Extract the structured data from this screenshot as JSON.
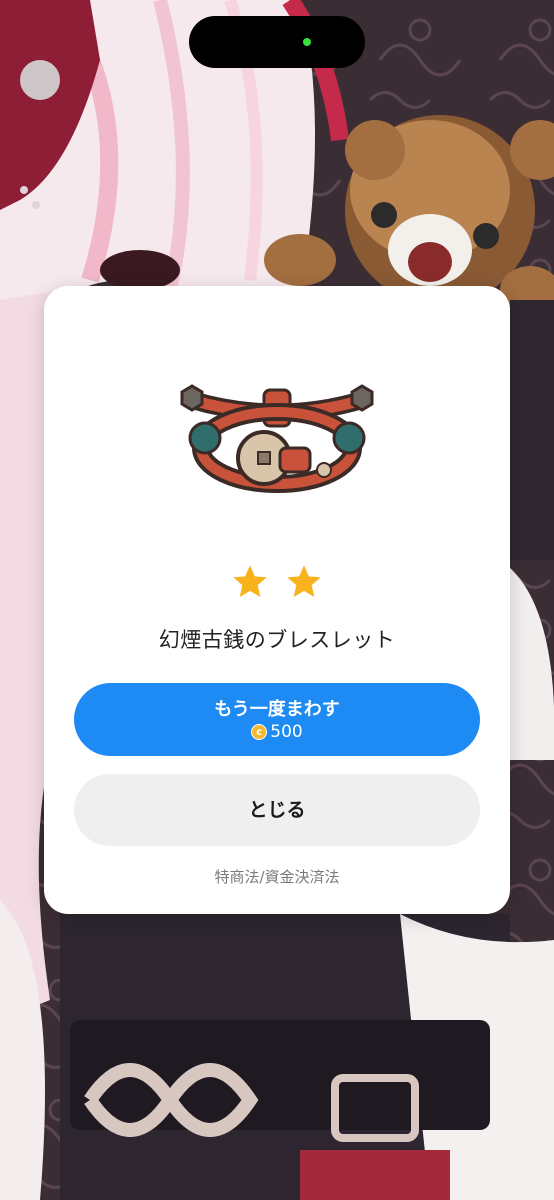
{
  "theme": {
    "accent": "#1e8bf5",
    "star_color": "#f7b21c",
    "close_button_bg": "#efefef"
  },
  "result": {
    "rarity_stars": 2,
    "item_name": "幻煙古銭のブレスレット"
  },
  "actions": {
    "spin_again_label": "もう一度まわす",
    "spin_again_price": "500",
    "currency_icon": "coin-icon",
    "close_label": "とじる"
  },
  "footer": {
    "legal_link": "特商法/資金決済法"
  }
}
